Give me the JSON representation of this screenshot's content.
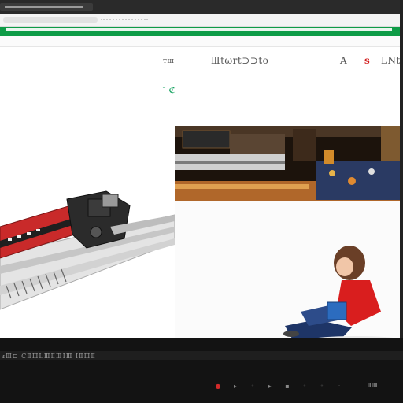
{
  "browser": {
    "address_text": "",
    "accent_color": "#0e9c47"
  },
  "header": {
    "small_mark": "тш",
    "title": "Ⅲtωrt⊃⊃to",
    "letter_a": "A",
    "red_mark": "s",
    "right_text": "ⅬΝtuo"
  },
  "content": {
    "sub_mark": "ˉ ℭ",
    "left_image": "machinery-illustration",
    "right_top_image": "workshop-photo",
    "right_bottom_image": "child-sitting-illustration"
  },
  "taskbar": {
    "status_text": "ⅎⅢ⊏ ⅭⅡⅢⅬⅢⅡⅢⅠⅢ ⅠⅡⅢⅡ",
    "tray_icons": [
      "record-icon",
      "play-icon",
      "circle-icon",
      "play-icon",
      "volume-icon",
      "wifi-icon",
      "circle-icon",
      "circle-icon"
    ],
    "tray_label": "ⅡⅢⅡ"
  }
}
